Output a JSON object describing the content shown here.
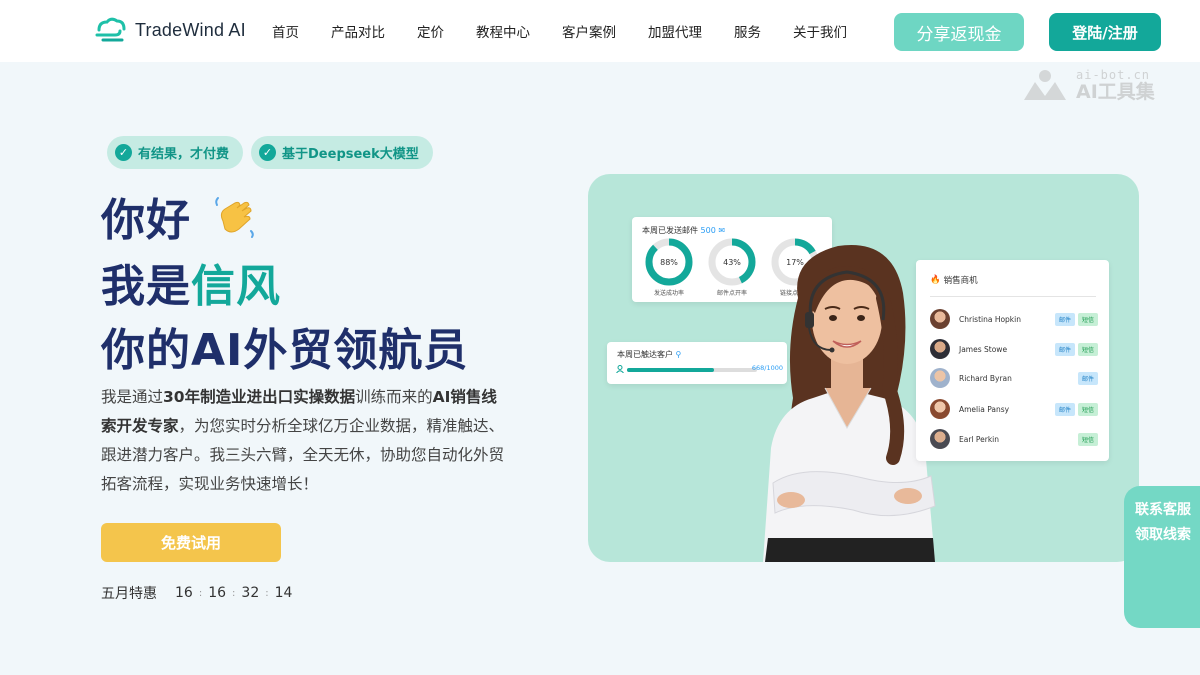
{
  "header": {
    "brand": "TradeWind AI",
    "nav": [
      "首页",
      "产品对比",
      "定价",
      "教程中心",
      "客户案例",
      "加盟代理",
      "服务",
      "关于我们"
    ],
    "share_button": "分享返现金",
    "login_button": "登陆/注册"
  },
  "watermark": {
    "line1": "ai-bot.cn",
    "line2": "AI工具集"
  },
  "badges": [
    "有结果，才付费",
    "基于Deepseek大模型"
  ],
  "hero": {
    "line1": "你好",
    "line2_prefix": "我是",
    "line2_accent": "信风",
    "line3": "你的AI外贸领航员",
    "desc_parts": [
      {
        "t": "我是通过",
        "b": false
      },
      {
        "t": "30年制造业进出口实操数据",
        "b": true
      },
      {
        "t": "训练而来的",
        "b": false
      },
      {
        "t": "AI销售线索开发专家",
        "b": true
      },
      {
        "t": "，为您实时分析全球亿万企业数据，精准触达、跟进潜力客户。我三头六臂，全天无休，协助您自动化外贸拓客流程，实现业务快速增长！",
        "b": false
      }
    ]
  },
  "cta": {
    "trial_button": "免费试用"
  },
  "promo": {
    "label": "五月特惠",
    "countdown": [
      "16",
      "16",
      "32",
      "14"
    ]
  },
  "showcase": {
    "email_card": {
      "title": "本周已发送邮件",
      "count": "500",
      "rings": [
        {
          "value": "88%",
          "label": "发送成功率",
          "pct": 88
        },
        {
          "value": "43%",
          "label": "邮件点开率",
          "pct": 43
        },
        {
          "value": "17%",
          "label": "链接点击率",
          "pct": 17
        }
      ]
    },
    "reach_card": {
      "title": "本周已触达客户",
      "value": "668/1000",
      "progress": 0.668
    },
    "sales_card": {
      "title": "销售商机",
      "rows": [
        {
          "name": "Christina Hopkin",
          "tags": [
            "邮件",
            "短信"
          ]
        },
        {
          "name": "James Stowe",
          "tags": [
            "邮件",
            "短信"
          ]
        },
        {
          "name": "Richard Byran",
          "tags": [
            "邮件"
          ]
        },
        {
          "name": "Amelia Pansy",
          "tags": [
            "邮件",
            "短信"
          ]
        },
        {
          "name": "Earl Perkin",
          "tags": [
            "短信"
          ]
        }
      ]
    }
  },
  "float_tab": {
    "line1": "联系客服",
    "line2": "领取线索"
  },
  "colors": {
    "primary": "#13a89a",
    "navy": "#1f2f6a",
    "yellow": "#f4c54c",
    "mint": "#b7e6d9"
  }
}
